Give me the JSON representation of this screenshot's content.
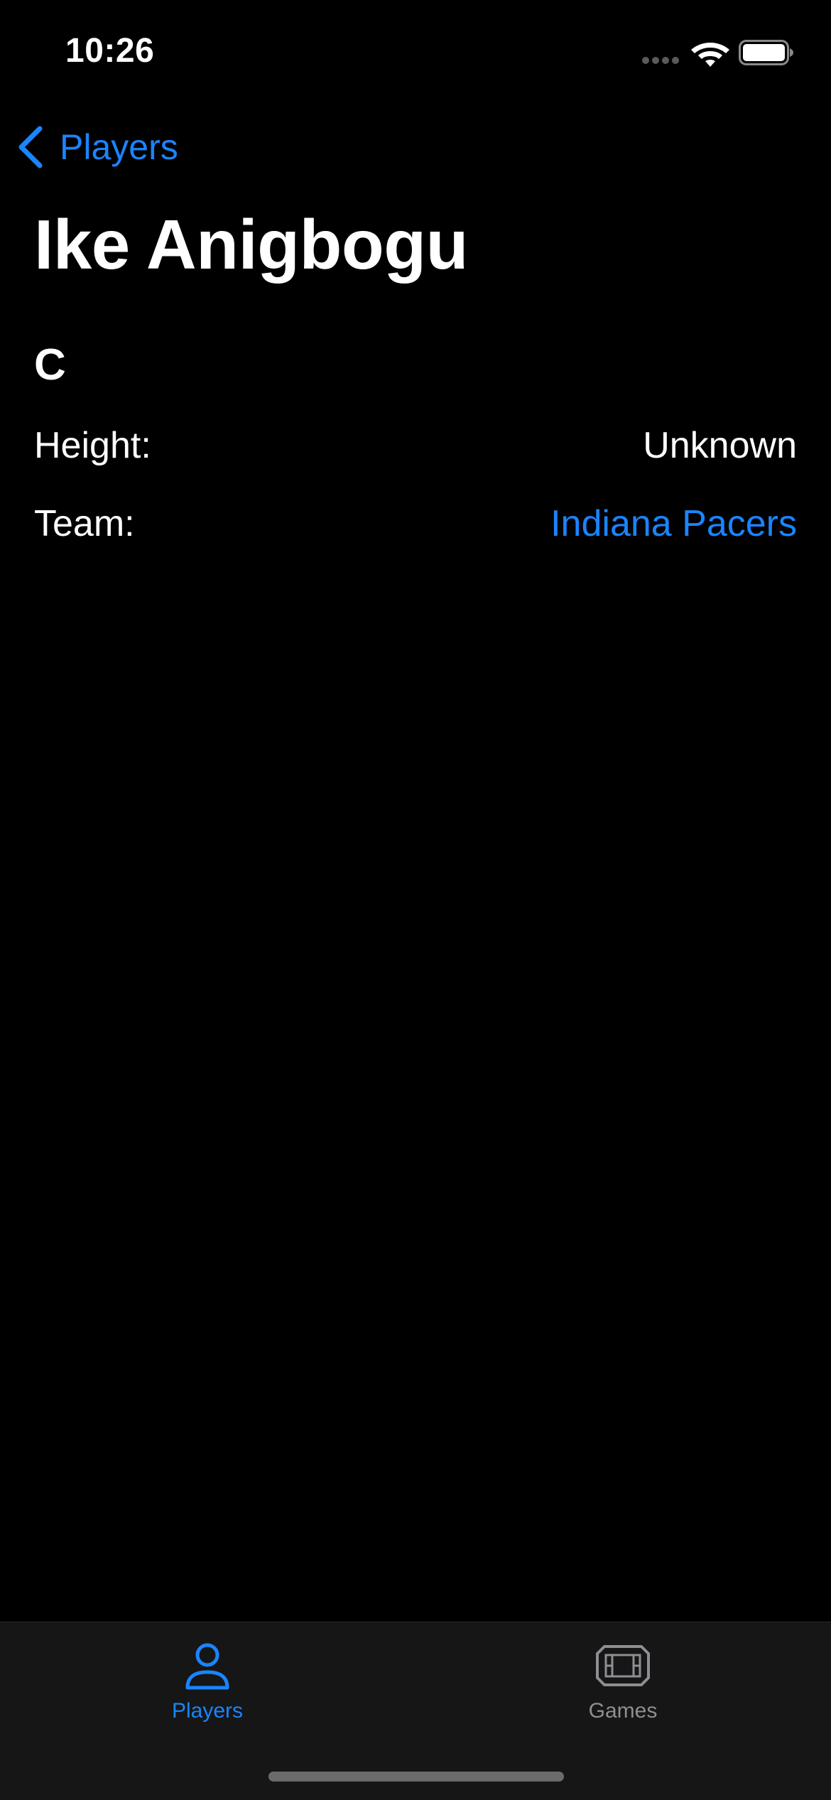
{
  "status_bar": {
    "time": "10:26"
  },
  "nav": {
    "back_label": "Players"
  },
  "player": {
    "name": "Ike Anigbogu",
    "position": "C",
    "height_label": "Height:",
    "height_value": "Unknown",
    "team_label": "Team:",
    "team_value": "Indiana Pacers"
  },
  "tab_bar": {
    "tabs": [
      {
        "label": "Players",
        "icon": "person-icon",
        "selected": true
      },
      {
        "label": "Games",
        "icon": "stadium-icon",
        "selected": false
      }
    ]
  },
  "colors": {
    "accent": "#1a84ff",
    "background": "#000000",
    "tab_bar_background": "#161616",
    "inactive": "#8e8e93"
  }
}
